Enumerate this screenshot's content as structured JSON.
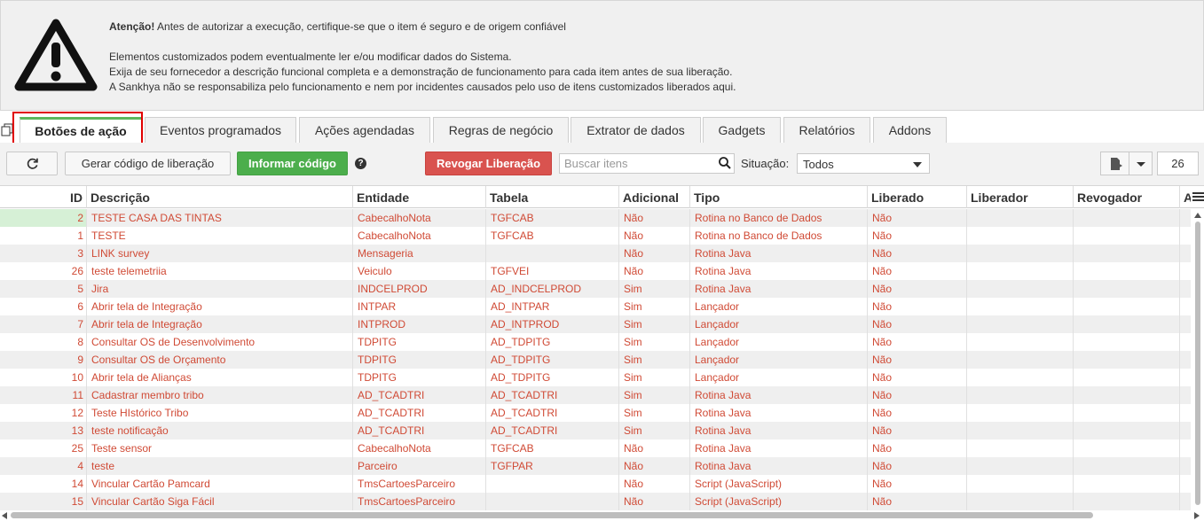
{
  "warning": {
    "title_bold": "Atenção!",
    "title_rest": " Antes de autorizar a execução, certifique-se que o item é seguro e de origem confiável",
    "line1": "Elementos customizados podem eventualmente ler e/ou modificar dados do Sistema.",
    "line2": "Exija de seu fornecedor a descrição funcional completa e a demonstração de funcionamento para cada item antes de sua liberação.",
    "line3": "A Sankhya não se responsabiliza pelo funcionamento e nem por incidentes causados pelo uso de itens customizados liberados aqui."
  },
  "tabs": [
    {
      "label": "Botões de ação",
      "active": true
    },
    {
      "label": "Eventos programados"
    },
    {
      "label": "Ações agendadas"
    },
    {
      "label": "Regras de negócio"
    },
    {
      "label": "Extrator de dados"
    },
    {
      "label": "Gadgets"
    },
    {
      "label": "Relatórios"
    },
    {
      "label": "Addons"
    }
  ],
  "toolbar": {
    "refresh_icon": "refresh-icon",
    "gen_code": "Gerar código de liberação",
    "inform_code": "Informar código",
    "help": "?",
    "revoke": "Revogar Liberação",
    "search_placeholder": "Buscar itens",
    "situation_label": "Situação:",
    "situation_value": "Todos",
    "count": "26"
  },
  "grid": {
    "columns": [
      "ID",
      "Descrição",
      "Entidade",
      "Tabela",
      "Adicional",
      "Tipo",
      "Liberado",
      "Liberador",
      "Revogador",
      "A"
    ],
    "rows": [
      [
        "2",
        "TESTE CASA DAS TINTAS",
        "CabecalhoNota",
        "TGFCAB",
        "Não",
        "Rotina no Banco de Dados",
        "Não"
      ],
      [
        "1",
        "TESTE",
        "CabecalhoNota",
        "TGFCAB",
        "Não",
        "Rotina no Banco de Dados",
        "Não"
      ],
      [
        "3",
        "LINK survey",
        "Mensageria",
        "",
        "Não",
        "Rotina Java",
        "Não"
      ],
      [
        "26",
        "teste telemetriia",
        "Veiculo",
        "TGFVEI",
        "Não",
        "Rotina Java",
        "Não"
      ],
      [
        "5",
        "Jira",
        "INDCELPROD",
        "AD_INDCELPROD",
        "Sim",
        "Rotina Java",
        "Não"
      ],
      [
        "6",
        "Abrir tela de Integração",
        "INTPAR",
        "AD_INTPAR",
        "Sim",
        "Lançador",
        "Não"
      ],
      [
        "7",
        "Abrir tela de Integração",
        "INTPROD",
        "AD_INTPROD",
        "Sim",
        "Lançador",
        "Não"
      ],
      [
        "8",
        "Consultar OS de Desenvolvimento",
        "TDPITG",
        "AD_TDPITG",
        "Sim",
        "Lançador",
        "Não"
      ],
      [
        "9",
        "Consultar OS de Orçamento",
        "TDPITG",
        "AD_TDPITG",
        "Sim",
        "Lançador",
        "Não"
      ],
      [
        "10",
        "Abrir tela de Alianças",
        "TDPITG",
        "AD_TDPITG",
        "Sim",
        "Lançador",
        "Não"
      ],
      [
        "11",
        "Cadastrar membro tribo",
        "AD_TCADTRI",
        "AD_TCADTRI",
        "Sim",
        "Rotina Java",
        "Não"
      ],
      [
        "12",
        "Teste HIstórico Tribo",
        "AD_TCADTRI",
        "AD_TCADTRI",
        "Sim",
        "Rotina Java",
        "Não"
      ],
      [
        "13",
        "teste notificação",
        "AD_TCADTRI",
        "AD_TCADTRI",
        "Sim",
        "Rotina Java",
        "Não"
      ],
      [
        "25",
        "Teste sensor",
        "CabecalhoNota",
        "TGFCAB",
        "Não",
        "Rotina Java",
        "Não"
      ],
      [
        "4",
        "teste",
        "Parceiro",
        "TGFPAR",
        "Não",
        "Rotina Java",
        "Não"
      ],
      [
        "14",
        "Vincular Cartão Pamcard",
        "TmsCartoesParceiro",
        "",
        "Não",
        "Script (JavaScript)",
        "Não"
      ],
      [
        "15",
        "Vincular Cartão Siga Fácil",
        "TmsCartoesParceiro",
        "",
        "Não",
        "Script (JavaScript)",
        "Não"
      ]
    ]
  }
}
